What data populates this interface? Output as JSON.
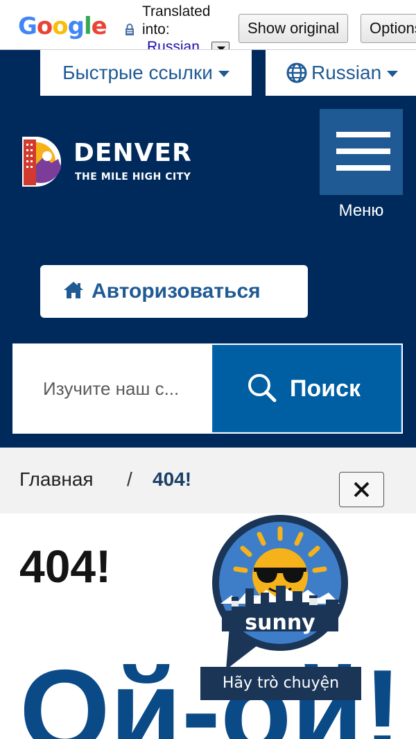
{
  "translate_bar": {
    "logo": "Google",
    "translated_label": "Translated into:",
    "language": "Russian",
    "show_original": "Show original",
    "options": "Options"
  },
  "header": {
    "quick_links": "Быстрые ссылки",
    "language": "Russian",
    "logo_title": "DENVER",
    "logo_subtitle": "THE MILE HIGH CITY",
    "menu_label": "Меню",
    "login": "Авторизоваться"
  },
  "search": {
    "placeholder": "Изучите наш с...",
    "button": "Поиск"
  },
  "breadcrumb": {
    "home": "Главная",
    "separator": "/",
    "current": "404!"
  },
  "main": {
    "error_code": "404!",
    "headline": "Ой-ой!"
  },
  "chat": {
    "bot_name": "sunny",
    "tooltip": "Hãy trò chuyện"
  },
  "colors": {
    "header_bg": "#002a5c",
    "accent": "#1f5a94",
    "search_button": "#005ea2",
    "headline": "#0a4a87"
  }
}
